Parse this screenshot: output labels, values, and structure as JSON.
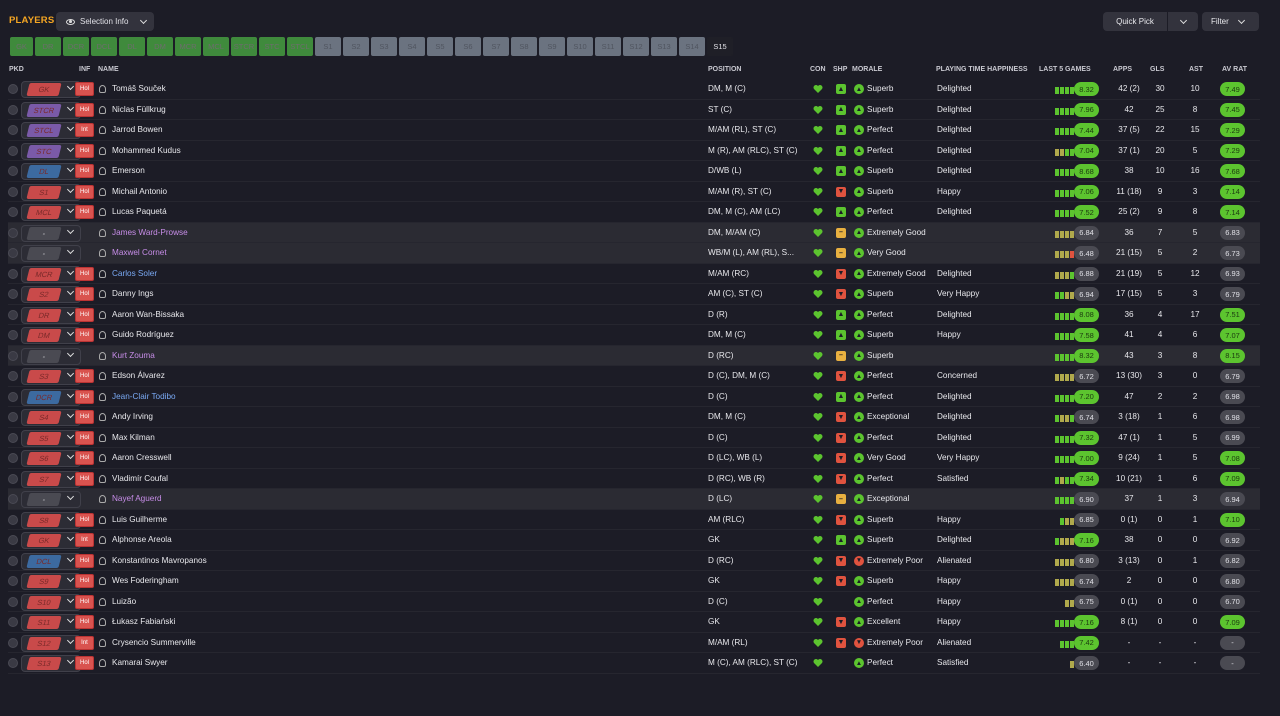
{
  "header": {
    "title": "PLAYERS",
    "selection_info": "Selection Info",
    "quick_pick": "Quick Pick",
    "filter": "Filter"
  },
  "tabs": [
    {
      "label": "GK",
      "kind": "g",
      "w": 23
    },
    {
      "label": "DR",
      "kind": "g",
      "w": 26
    },
    {
      "label": "DCR",
      "kind": "g",
      "w": 26
    },
    {
      "label": "DCL",
      "kind": "g",
      "w": 26
    },
    {
      "label": "DL",
      "kind": "g",
      "w": 26
    },
    {
      "label": "DM",
      "kind": "g",
      "w": 26
    },
    {
      "label": "MCR",
      "kind": "g",
      "w": 26
    },
    {
      "label": "MCL",
      "kind": "g",
      "w": 26
    },
    {
      "label": "STCR",
      "kind": "g",
      "w": 26
    },
    {
      "label": "STC",
      "kind": "g",
      "w": 26
    },
    {
      "label": "STCL",
      "kind": "g",
      "w": 26
    },
    {
      "label": "S1",
      "kind": "s",
      "w": 26
    },
    {
      "label": "S2",
      "kind": "s",
      "w": 26
    },
    {
      "label": "S3",
      "kind": "s",
      "w": 26
    },
    {
      "label": "S4",
      "kind": "s",
      "w": 26
    },
    {
      "label": "S5",
      "kind": "s",
      "w": 26
    },
    {
      "label": "S6",
      "kind": "s",
      "w": 26
    },
    {
      "label": "S7",
      "kind": "s",
      "w": 26
    },
    {
      "label": "S8",
      "kind": "s",
      "w": 26
    },
    {
      "label": "S9",
      "kind": "s",
      "w": 26
    },
    {
      "label": "S10",
      "kind": "s",
      "w": 26
    },
    {
      "label": "S11",
      "kind": "s",
      "w": 26
    },
    {
      "label": "S12",
      "kind": "s",
      "w": 26
    },
    {
      "label": "S13",
      "kind": "s",
      "w": 26
    },
    {
      "label": "S14",
      "kind": "s",
      "w": 26
    },
    {
      "label": "S15",
      "kind": "a",
      "w": 26
    }
  ],
  "columns": {
    "pkd": "PKD",
    "inf": "INF",
    "name": "NAME",
    "position": "POSITION",
    "con": "CON",
    "shp": "SHP",
    "morale": "MORALE",
    "pth": "PLAYING TIME HAPPINESS",
    "last5": "LAST 5 GAMES",
    "apps": "APPS",
    "gls": "GLS",
    "ast": "AST",
    "avrat": "AV RAT"
  },
  "colors": {
    "green": "#5cc42f",
    "lime": "#8fbf3a",
    "olive": "#b0a94c",
    "red": "#e0533f",
    "yellow": "#e8b040",
    "gray": "#4a4a52"
  },
  "players": [
    {
      "pick": "GK",
      "pc": "#c94a4a",
      "inf": "Hol",
      "name": "Tomáš Souček",
      "nc": "",
      "pos": "DM, M (C)",
      "shp": "up",
      "mor": "up",
      "morale": "Superb",
      "pth": "Delighted",
      "l5": [
        "g",
        "g",
        "g",
        "g"
      ],
      "lr": "8.32",
      "lrc": "g",
      "apps": "42 (2)",
      "gls": "30",
      "ast": "10",
      "av": "7.49",
      "avc": "g",
      "hl": false
    },
    {
      "pick": "STCR",
      "pc": "#7a5aa8",
      "inf": "Hol",
      "name": "Niclas Füllkrug",
      "nc": "",
      "pos": "ST (C)",
      "shp": "up",
      "mor": "up",
      "morale": "Superb",
      "pth": "Delighted",
      "l5": [
        "g",
        "g",
        "g",
        "g"
      ],
      "lr": "7.96",
      "lrc": "g",
      "apps": "42",
      "gls": "25",
      "ast": "8",
      "av": "7.45",
      "avc": "g",
      "hl": false
    },
    {
      "pick": "STCL",
      "pc": "#7a5aa8",
      "inf": "Int",
      "name": "Jarrod Bowen",
      "nc": "",
      "pos": "M/AM (RL), ST (C)",
      "shp": "up",
      "mor": "up",
      "morale": "Perfect",
      "pth": "Delighted",
      "l5": [
        "g",
        "g",
        "g",
        "g"
      ],
      "lr": "7.44",
      "lrc": "g",
      "apps": "37 (5)",
      "gls": "22",
      "ast": "15",
      "av": "7.29",
      "avc": "g",
      "hl": false
    },
    {
      "pick": "STC",
      "pc": "#7a5aa8",
      "inf": "Hol",
      "name": "Mohammed Kudus",
      "nc": "",
      "pos": "M (R), AM (RLC), ST (C)",
      "shp": "up",
      "mor": "up",
      "morale": "Perfect",
      "pth": "Delighted",
      "l5": [
        "o",
        "o",
        "g",
        "g"
      ],
      "lr": "7.04",
      "lrc": "g",
      "apps": "37 (1)",
      "gls": "20",
      "ast": "5",
      "av": "7.29",
      "avc": "g",
      "hl": false
    },
    {
      "pick": "DL",
      "pc": "#3c6aa0",
      "inf": "Hol",
      "name": "Emerson",
      "nc": "",
      "pos": "D/WB (L)",
      "shp": "up",
      "mor": "up",
      "morale": "Superb",
      "pth": "Delighted",
      "l5": [
        "g",
        "g",
        "g",
        "g"
      ],
      "lr": "8.68",
      "lrc": "g",
      "apps": "38",
      "gls": "10",
      "ast": "16",
      "av": "7.68",
      "avc": "g",
      "hl": false
    },
    {
      "pick": "S1",
      "pc": "#c94a4a",
      "inf": "Hol",
      "name": "Michail Antonio",
      "nc": "",
      "pos": "M/AM (R), ST (C)",
      "shp": "down",
      "mor": "up",
      "morale": "Superb",
      "pth": "Happy",
      "l5": [
        "g",
        "g",
        "g",
        "g"
      ],
      "lr": "7.06",
      "lrc": "g",
      "apps": "11 (18)",
      "gls": "9",
      "ast": "3",
      "av": "7.14",
      "avc": "g",
      "hl": false
    },
    {
      "pick": "MCL",
      "pc": "#c94a4a",
      "inf": "Hol",
      "name": "Lucas Paquetá",
      "nc": "",
      "pos": "DM, M (C), AM (LC)",
      "shp": "up",
      "mor": "up",
      "morale": "Perfect",
      "pth": "Delighted",
      "l5": [
        "g",
        "g",
        "g",
        "g"
      ],
      "lr": "7.52",
      "lrc": "g",
      "apps": "25 (2)",
      "gls": "9",
      "ast": "8",
      "av": "7.14",
      "avc": "g",
      "hl": false
    },
    {
      "pick": "-",
      "pc": "#4a4a52",
      "inf": "",
      "name": "James Ward-Prowse",
      "nc": "pur",
      "pos": "DM, M/AM (C)",
      "shp": "eq",
      "mor": "up",
      "morale": "Extremely Good",
      "pth": "",
      "l5": [
        "o",
        "o",
        "o",
        "o"
      ],
      "lr": "6.84",
      "lrc": "n",
      "apps": "36",
      "gls": "7",
      "ast": "5",
      "av": "6.83",
      "avc": "n",
      "hl": true
    },
    {
      "pick": "-",
      "pc": "#4a4a52",
      "inf": "",
      "name": "Maxwel Cornet",
      "nc": "pur",
      "pos": "WB/M (L), AM (RL), S...",
      "shp": "eq",
      "mor": "up",
      "morale": "Very Good",
      "pth": "",
      "l5": [
        "o",
        "o",
        "o",
        "r"
      ],
      "lr": "6.48",
      "lrc": "n",
      "apps": "21 (15)",
      "gls": "5",
      "ast": "2",
      "av": "6.73",
      "avc": "n",
      "hl": true
    },
    {
      "pick": "MCR",
      "pc": "#c94a4a",
      "inf": "Hol",
      "name": "Carlos Soler",
      "nc": "blu",
      "pos": "M/AM (RC)",
      "shp": "down",
      "mor": "up",
      "morale": "Extremely Good",
      "pth": "Delighted",
      "l5": [
        "o",
        "o",
        "o",
        "g"
      ],
      "lr": "6.88",
      "lrc": "n",
      "apps": "21 (19)",
      "gls": "5",
      "ast": "12",
      "av": "6.93",
      "avc": "n",
      "hl": false
    },
    {
      "pick": "S2",
      "pc": "#c94a4a",
      "inf": "Hol",
      "name": "Danny Ings",
      "nc": "",
      "pos": "AM (C), ST (C)",
      "shp": "down",
      "mor": "up",
      "morale": "Superb",
      "pth": "Very Happy",
      "l5": [
        "g",
        "g",
        "o",
        "o"
      ],
      "lr": "6.94",
      "lrc": "n",
      "apps": "17 (15)",
      "gls": "5",
      "ast": "3",
      "av": "6.79",
      "avc": "n",
      "hl": false
    },
    {
      "pick": "DR",
      "pc": "#c94a4a",
      "inf": "Hol",
      "name": "Aaron Wan-Bissaka",
      "nc": "",
      "pos": "D (R)",
      "shp": "up",
      "mor": "up",
      "morale": "Perfect",
      "pth": "Delighted",
      "l5": [
        "g",
        "g",
        "g",
        "g"
      ],
      "lr": "8.08",
      "lrc": "g",
      "apps": "36",
      "gls": "4",
      "ast": "17",
      "av": "7.51",
      "avc": "g",
      "hl": false
    },
    {
      "pick": "DM",
      "pc": "#c94a4a",
      "inf": "Hol",
      "name": "Guido Rodríguez",
      "nc": "",
      "pos": "DM, M (C)",
      "shp": "up",
      "mor": "up",
      "morale": "Superb",
      "pth": "Happy",
      "l5": [
        "g",
        "g",
        "g",
        "g"
      ],
      "lr": "7.58",
      "lrc": "g",
      "apps": "41",
      "gls": "4",
      "ast": "6",
      "av": "7.07",
      "avc": "g",
      "hl": false
    },
    {
      "pick": "-",
      "pc": "#4a4a52",
      "inf": "",
      "name": "Kurt Zouma",
      "nc": "pur",
      "pos": "D (RC)",
      "shp": "eq",
      "mor": "up",
      "morale": "Superb",
      "pth": "",
      "l5": [
        "g",
        "g",
        "g",
        "g"
      ],
      "lr": "8.32",
      "lrc": "g",
      "apps": "43",
      "gls": "3",
      "ast": "8",
      "av": "8.15",
      "avc": "g",
      "hl": true
    },
    {
      "pick": "S3",
      "pc": "#c94a4a",
      "inf": "Hol",
      "name": "Edson Álvarez",
      "nc": "",
      "pos": "D (C), DM, M (C)",
      "shp": "down",
      "mor": "up",
      "morale": "Perfect",
      "pth": "Concerned",
      "l5": [
        "o",
        "o",
        "o",
        "o"
      ],
      "lr": "6.72",
      "lrc": "n",
      "apps": "13 (30)",
      "gls": "3",
      "ast": "0",
      "av": "6.79",
      "avc": "n",
      "hl": false
    },
    {
      "pick": "DCR",
      "pc": "#3c6aa0",
      "inf": "Hol",
      "name": "Jean-Clair Todibo",
      "nc": "blu",
      "pos": "D (C)",
      "shp": "up",
      "mor": "up",
      "morale": "Perfect",
      "pth": "Delighted",
      "l5": [
        "g",
        "g",
        "g",
        "g"
      ],
      "lr": "7.20",
      "lrc": "g",
      "apps": "47",
      "gls": "2",
      "ast": "2",
      "av": "6.98",
      "avc": "n",
      "hl": false
    },
    {
      "pick": "S4",
      "pc": "#c94a4a",
      "inf": "Hol",
      "name": "Andy Irving",
      "nc": "",
      "pos": "DM, M (C)",
      "shp": "down",
      "mor": "up",
      "morale": "Exceptional",
      "pth": "Delighted",
      "l5": [
        "g",
        "o",
        "o",
        "g"
      ],
      "lr": "6.74",
      "lrc": "n",
      "apps": "3 (18)",
      "gls": "1",
      "ast": "6",
      "av": "6.98",
      "avc": "n",
      "hl": false
    },
    {
      "pick": "S5",
      "pc": "#c94a4a",
      "inf": "Hol",
      "name": "Max Kilman",
      "nc": "",
      "pos": "D (C)",
      "shp": "down",
      "mor": "up",
      "morale": "Perfect",
      "pth": "Delighted",
      "l5": [
        "g",
        "g",
        "g",
        "g"
      ],
      "lr": "7.32",
      "lrc": "g",
      "apps": "47 (1)",
      "gls": "1",
      "ast": "5",
      "av": "6.99",
      "avc": "n",
      "hl": false
    },
    {
      "pick": "S6",
      "pc": "#c94a4a",
      "inf": "Hol",
      "name": "Aaron Cresswell",
      "nc": "",
      "pos": "D (LC), WB (L)",
      "shp": "down",
      "mor": "up",
      "morale": "Very Good",
      "pth": "Very Happy",
      "l5": [
        "g",
        "g",
        "g",
        "g"
      ],
      "lr": "7.00",
      "lrc": "g",
      "apps": "9 (24)",
      "gls": "1",
      "ast": "5",
      "av": "7.08",
      "avc": "g",
      "hl": false
    },
    {
      "pick": "S7",
      "pc": "#c94a4a",
      "inf": "Hol",
      "name": "Vladimír Coufal",
      "nc": "",
      "pos": "D (RC), WB (R)",
      "shp": "down",
      "mor": "up",
      "morale": "Perfect",
      "pth": "Satisfied",
      "l5": [
        "g",
        "o",
        "g",
        "g"
      ],
      "lr": "7.34",
      "lrc": "g",
      "apps": "10 (21)",
      "gls": "1",
      "ast": "6",
      "av": "7.09",
      "avc": "g",
      "hl": false
    },
    {
      "pick": "-",
      "pc": "#4a4a52",
      "inf": "",
      "name": "Nayef Aguerd",
      "nc": "pur",
      "pos": "D (LC)",
      "shp": "eq",
      "mor": "up",
      "morale": "Exceptional",
      "pth": "",
      "l5": [
        "g",
        "g",
        "g",
        "g"
      ],
      "lr": "6.90",
      "lrc": "n",
      "apps": "37",
      "gls": "1",
      "ast": "3",
      "av": "6.94",
      "avc": "n",
      "hl": true
    },
    {
      "pick": "S8",
      "pc": "#c94a4a",
      "inf": "Hol",
      "name": "Luis Guilherme",
      "nc": "",
      "pos": "AM (RLC)",
      "shp": "down",
      "mor": "up",
      "morale": "Superb",
      "pth": "Happy",
      "l5": [
        "g",
        "o",
        "o"
      ],
      "lr": "6.85",
      "lrc": "n",
      "apps": "0 (1)",
      "gls": "0",
      "ast": "1",
      "av": "7.10",
      "avc": "g",
      "hl": false
    },
    {
      "pick": "GK",
      "pc": "#c94a4a",
      "inf": "Int",
      "name": "Alphonse Areola",
      "nc": "",
      "pos": "GK",
      "shp": "up",
      "mor": "up",
      "morale": "Superb",
      "pth": "Delighted",
      "l5": [
        "g",
        "o",
        "o",
        "o"
      ],
      "lr": "7.16",
      "lrc": "g",
      "apps": "38",
      "gls": "0",
      "ast": "0",
      "av": "6.92",
      "avc": "n",
      "hl": false
    },
    {
      "pick": "DCL",
      "pc": "#3c6aa0",
      "inf": "Hol",
      "name": "Konstantinos Mavropanos",
      "nc": "",
      "pos": "D (RC)",
      "shp": "down",
      "mor": "down",
      "morale": "Extremely Poor",
      "pth": "Alienated",
      "l5": [
        "o",
        "o",
        "o",
        "o"
      ],
      "lr": "6.80",
      "lrc": "n",
      "apps": "3 (13)",
      "gls": "0",
      "ast": "1",
      "av": "6.82",
      "avc": "n",
      "hl": false
    },
    {
      "pick": "S9",
      "pc": "#c94a4a",
      "inf": "Hol",
      "name": "Wes Foderingham",
      "nc": "",
      "pos": "GK",
      "shp": "down",
      "mor": "up",
      "morale": "Superb",
      "pth": "Happy",
      "l5": [
        "o",
        "o",
        "o",
        "o"
      ],
      "lr": "6.74",
      "lrc": "n",
      "apps": "2",
      "gls": "0",
      "ast": "0",
      "av": "6.80",
      "avc": "n",
      "hl": false
    },
    {
      "pick": "S10",
      "pc": "#c94a4a",
      "inf": "Hol",
      "name": "Luizão",
      "nc": "",
      "pos": "D (C)",
      "shp": "",
      "mor": "up",
      "morale": "Perfect",
      "pth": "Happy",
      "l5": [
        "o",
        "o"
      ],
      "lr": "6.75",
      "lrc": "n",
      "apps": "0 (1)",
      "gls": "0",
      "ast": "0",
      "av": "6.70",
      "avc": "n",
      "hl": false
    },
    {
      "pick": "S11",
      "pc": "#c94a4a",
      "inf": "Hol",
      "name": "Łukasz Fabiański",
      "nc": "",
      "pos": "GK",
      "shp": "down",
      "mor": "up",
      "morale": "Excellent",
      "pth": "Happy",
      "l5": [
        "g",
        "g",
        "g",
        "g"
      ],
      "lr": "7.16",
      "lrc": "g",
      "apps": "8 (1)",
      "gls": "0",
      "ast": "0",
      "av": "7.09",
      "avc": "g",
      "hl": false
    },
    {
      "pick": "S12",
      "pc": "#c94a4a",
      "inf": "Int",
      "name": "Crysencio Summerville",
      "nc": "",
      "pos": "M/AM (RL)",
      "shp": "down",
      "mor": "down",
      "morale": "Extremely Poor",
      "pth": "Alienated",
      "l5": [
        "g",
        "g",
        "g"
      ],
      "lr": "7.42",
      "lrc": "g",
      "apps": "-",
      "gls": "-",
      "ast": "-",
      "av": "-",
      "avc": "n",
      "hl": false
    },
    {
      "pick": "S13",
      "pc": "#c94a4a",
      "inf": "Hol",
      "name": "Kamarai Swyer",
      "nc": "",
      "pos": "M (C), AM (RLC), ST (C)",
      "shp": "",
      "mor": "up",
      "morale": "Perfect",
      "pth": "Satisfied",
      "l5": [
        "o"
      ],
      "lr": "6.40",
      "lrc": "n",
      "apps": "-",
      "gls": "-",
      "ast": "-",
      "av": "-",
      "avc": "n",
      "hl": false
    }
  ]
}
